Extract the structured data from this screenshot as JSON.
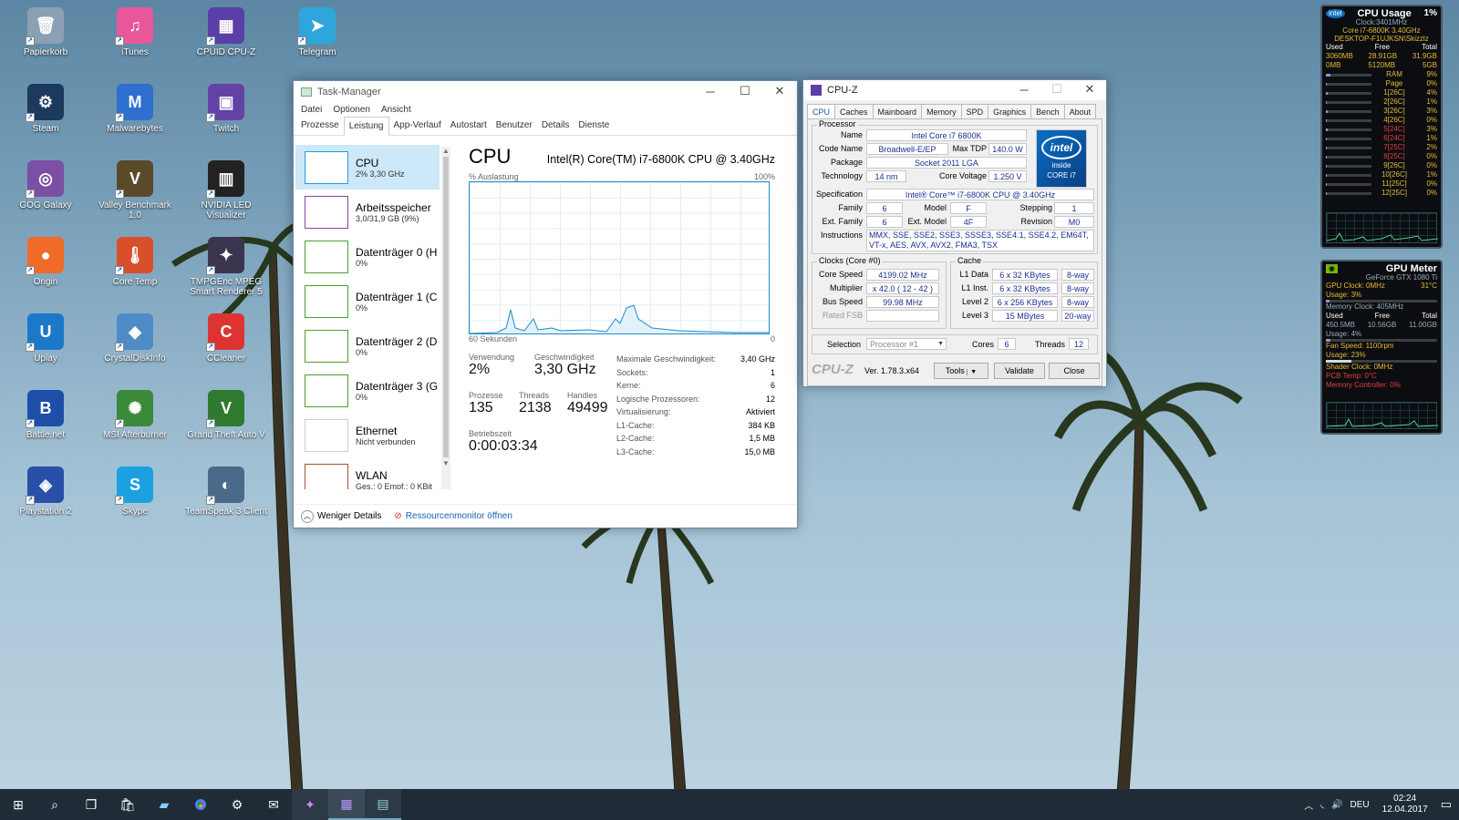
{
  "desktop_icons": [
    {
      "label": "Papierkorb",
      "glyph": "🗑",
      "color": "#8aa0b3"
    },
    {
      "label": "iTunes",
      "glyph": "♫",
      "color": "#e8579a"
    },
    {
      "label": "CPUID CPU-Z",
      "glyph": "▦",
      "color": "#5a3fa8"
    },
    {
      "label": "Telegram",
      "glyph": "➤",
      "color": "#2ea6dc"
    },
    {
      "label": "Steam",
      "glyph": "⚙",
      "color": "#1b3a5c"
    },
    {
      "label": "Malwarebytes",
      "glyph": "M",
      "color": "#2f6fd0"
    },
    {
      "label": "Twitch",
      "glyph": "▣",
      "color": "#6441a5"
    },
    {
      "label": "GOG Galaxy",
      "glyph": "◎",
      "color": "#7b4fa3"
    },
    {
      "label": "Valley Benchmark 1.0",
      "glyph": "V",
      "color": "#5a4a2a"
    },
    {
      "label": "NVIDIA LED Visualizer",
      "glyph": "▥",
      "color": "#222"
    },
    {
      "label": "Origin",
      "glyph": "●",
      "color": "#f06b28"
    },
    {
      "label": "Core Temp",
      "glyph": "🌡",
      "color": "#d94f2a"
    },
    {
      "label": "TMPGEnc MPEG Smart Renderer 5",
      "glyph": "✦",
      "color": "#3b3550"
    },
    {
      "label": "Uplay",
      "glyph": "U",
      "color": "#1c78c8"
    },
    {
      "label": "CrystalDiskInfo",
      "glyph": "◆",
      "color": "#4d8cc6"
    },
    {
      "label": "CCleaner",
      "glyph": "C",
      "color": "#d33"
    },
    {
      "label": "Battle.net",
      "glyph": "B",
      "color": "#1e4fa8"
    },
    {
      "label": "MSI Afterburner",
      "glyph": "✺",
      "color": "#3a8a3a"
    },
    {
      "label": "Grand Theft Auto V",
      "glyph": "V",
      "color": "#2f7a2f"
    },
    {
      "label": "Playstation 2",
      "glyph": "◈",
      "color": "#2a4fa8"
    },
    {
      "label": "Skype",
      "glyph": "S",
      "color": "#1ba1e2"
    },
    {
      "label": "TeamSpeak 3 Client",
      "glyph": "◐",
      "color": "#4a6a8a"
    }
  ],
  "taskmanager": {
    "title": "Task-Manager",
    "menu": [
      "Datei",
      "Optionen",
      "Ansicht"
    ],
    "tabs": [
      "Prozesse",
      "Leistung",
      "App-Verlauf",
      "Autostart",
      "Benutzer",
      "Details",
      "Dienste"
    ],
    "active_tab": "Leistung",
    "resources": [
      {
        "name": "CPU",
        "sub": "2% 3,30 GHz"
      },
      {
        "name": "Arbeitsspeicher",
        "sub": "3,0/31,9 GB (9%)"
      },
      {
        "name": "Datenträger 0 (H",
        "sub": "0%"
      },
      {
        "name": "Datenträger 1 (C",
        "sub": "0%"
      },
      {
        "name": "Datenträger 2 (D",
        "sub": "0%"
      },
      {
        "name": "Datenträger 3 (G",
        "sub": "0%"
      },
      {
        "name": "Ethernet",
        "sub": "Nicht verbunden"
      },
      {
        "name": "WLAN",
        "sub": "Ges.: 0 Empf.: 0 KBit"
      }
    ],
    "main": {
      "heading": "CPU",
      "cpu_name": "Intel(R) Core(TM) i7-6800K CPU @ 3.40GHz",
      "graph_label": "% Auslastung",
      "graph_max": "100%",
      "graph_time": "60 Sekunden",
      "graph_min": "0",
      "usage_label": "Verwendung",
      "usage": "2%",
      "speed_label": "Geschwindigkeit",
      "speed": "3,30 GHz",
      "proc_label": "Prozesse",
      "proc": "135",
      "threads_label": "Threads",
      "threads": "2138",
      "handles_label": "Handles",
      "handles": "49499",
      "uptime_label": "Betriebszeit",
      "uptime": "0:00:03:34",
      "specs": [
        [
          "Maximale Geschwindigkeit:",
          "3,40 GHz"
        ],
        [
          "Sockets:",
          "1"
        ],
        [
          "Kerne:",
          "6"
        ],
        [
          "Logische Prozessoren:",
          "12"
        ],
        [
          "Virtualisierung:",
          "Aktiviert"
        ],
        [
          "L1-Cache:",
          "384 KB"
        ],
        [
          "L2-Cache:",
          "1,5 MB"
        ],
        [
          "L3-Cache:",
          "15,0 MB"
        ]
      ]
    },
    "footer": {
      "less": "Weniger Details",
      "monitor": "Ressourcenmonitor öffnen"
    }
  },
  "cpuz": {
    "title": "CPU-Z",
    "tabs": [
      "CPU",
      "Caches",
      "Mainboard",
      "Memory",
      "SPD",
      "Graphics",
      "Bench",
      "About"
    ],
    "processor_label": "Processor",
    "name_l": "Name",
    "name": "Intel Core i7 6800K",
    "code_l": "Code Name",
    "code": "Broadwell-E/EP",
    "tdp_l": "Max TDP",
    "tdp": "140.0 W",
    "package_l": "Package",
    "package": "Socket 2011 LGA",
    "tech_l": "Technology",
    "tech": "14 nm",
    "volt_l": "Core Voltage",
    "volt": "1.250 V",
    "spec_l": "Specification",
    "spec": "Intel® Core™ i7-6800K CPU @ 3.40GHz",
    "family_l": "Family",
    "family": "6",
    "model_l": "Model",
    "model": "F",
    "stepping_l": "Stepping",
    "stepping": "1",
    "extfam_l": "Ext. Family",
    "extfam": "6",
    "extmod_l": "Ext. Model",
    "extmod": "4F",
    "rev_l": "Revision",
    "rev": "M0",
    "instr_l": "Instructions",
    "instr": "MMX, SSE, SSE2, SSE3, SSSE3, SSE4.1, SSE4.2, EM64T, VT-x, AES, AVX, AVX2, FMA3, TSX",
    "clocks_label": "Clocks (Core #0)",
    "corespeed_l": "Core Speed",
    "corespeed": "4199.02 MHz",
    "mult_l": "Multiplier",
    "mult": "x 42.0 ( 12 - 42 )",
    "bus_l": "Bus Speed",
    "bus": "99.98 MHz",
    "fsb_l": "Rated FSB",
    "fsb": "",
    "cache_label": "Cache",
    "caches": [
      [
        "L1 Data",
        "6 x 32 KBytes",
        "8-way"
      ],
      [
        "L1 Inst.",
        "6 x 32 KBytes",
        "8-way"
      ],
      [
        "Level 2",
        "6 x 256 KBytes",
        "8-way"
      ],
      [
        "Level 3",
        "15 MBytes",
        "20-way"
      ]
    ],
    "selection_l": "Selection",
    "selection": "Processor #1",
    "cores_l": "Cores",
    "cores": "6",
    "threads_l": "Threads",
    "threads": "12",
    "brand": "CPU-Z",
    "version": "Ver. 1.78.3.x64",
    "tools": "Tools",
    "validate": "Validate",
    "close": "Close",
    "logo_text": "intel",
    "logo_inside": "inside",
    "logo_core": "CORE i7"
  },
  "gadget_cpu": {
    "title": "CPU Usage",
    "pct": "1%",
    "clock": "Clock:3401MHz",
    "model": "Core i7-6800K 3.40GHz",
    "host": "DESKTOP-F1UJKSN\\Skizzlz",
    "cols": [
      "Used",
      "Free",
      "Total"
    ],
    "r1": [
      "3060MB",
      "28.91GB",
      "31.9GB"
    ],
    "r2": [
      "0MB",
      "5120MB",
      "5GB"
    ],
    "rows": [
      [
        "RAM",
        "9%"
      ],
      [
        "Page",
        "0%"
      ],
      [
        "1[26C]",
        "4%"
      ],
      [
        "2[26C]",
        "1%"
      ],
      [
        "3[26C]",
        "3%"
      ],
      [
        "4[26C]",
        "0%"
      ],
      [
        "5[24C]",
        "3%"
      ],
      [
        "6[24C]",
        "1%"
      ],
      [
        "7[25C]",
        "2%"
      ],
      [
        "8[25C]",
        "0%"
      ],
      [
        "9[26C]",
        "0%"
      ],
      [
        "10[26C]",
        "1%"
      ],
      [
        "11[25C]",
        "0%"
      ],
      [
        "12[25C]",
        "0%"
      ]
    ]
  },
  "gadget_gpu": {
    "title": "GPU Meter",
    "card": "GeForce GTX 1080 Ti",
    "clock": "GPU Clock: 0MHz",
    "temp": "31°C",
    "usage": "Usage: 3%",
    "mem_clock": "Memory Clock: 405MHz",
    "cols": [
      "Used",
      "Free",
      "Total"
    ],
    "mem": [
      "450.5MB",
      "10.56GB",
      "11.00GB"
    ],
    "mem_usage": "Usage: 4%",
    "fan": "Fan Speed: 1100rpm",
    "fan_usage": "Usage: 23%",
    "shader": "Shader Clock: 0MHz",
    "pcb": "PCB Temp: 0°C",
    "memctrl": "Memory Controller: 0%"
  },
  "taskbar": {
    "lang": "DEU",
    "time": "02:24",
    "date": "12.04.2017"
  }
}
